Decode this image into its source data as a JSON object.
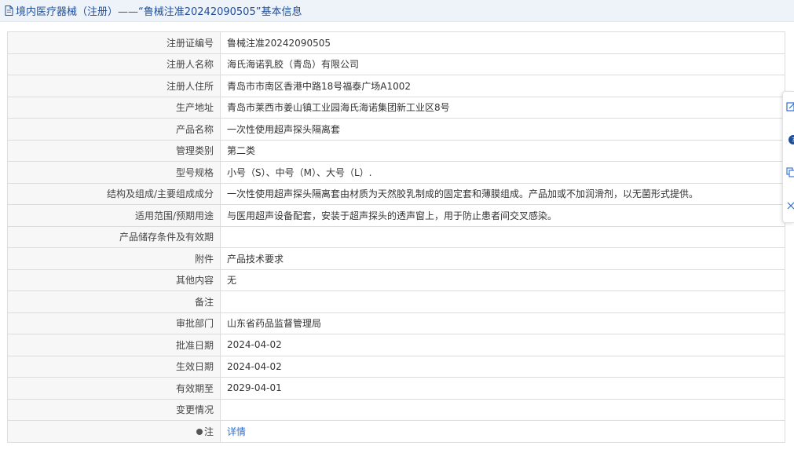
{
  "header": {
    "title": "境内医疗器械（注册）——“鲁械注准20242090505”基本信息",
    "icon": "document-icon"
  },
  "fields": [
    {
      "label": "注册证编号",
      "value": "鲁械注准20242090505"
    },
    {
      "label": "注册人名称",
      "value": "海氏海诺乳胶（青岛）有限公司"
    },
    {
      "label": "注册人住所",
      "value": "青岛市市南区香港中路18号福泰广场A1002"
    },
    {
      "label": "生产地址",
      "value": "青岛市莱西市姜山镇工业园海氏海诺集团新工业区8号"
    },
    {
      "label": "产品名称",
      "value": "一次性使用超声探头隔离套"
    },
    {
      "label": "管理类别",
      "value": "第二类"
    },
    {
      "label": "型号规格",
      "value": "小号（S）、中号（M）、大号（L）."
    },
    {
      "label": "结构及组成/主要组成成分",
      "value": "一次性使用超声探头隔离套由材质为天然胶乳制成的固定套和薄膜组成。产品加或不加润滑剂，以无菌形式提供。"
    },
    {
      "label": "适用范围/预期用途",
      "value": "与医用超声设备配套，安装于超声探头的透声窗上，用于防止患者间交叉感染。"
    },
    {
      "label": "产品储存条件及有效期",
      "value": ""
    },
    {
      "label": "附件",
      "value": "产品技术要求"
    },
    {
      "label": "其他内容",
      "value": "无"
    },
    {
      "label": "备注",
      "value": ""
    },
    {
      "label": "审批部门",
      "value": "山东省药品监督管理局"
    },
    {
      "label": "批准日期",
      "value": "2024-04-02"
    },
    {
      "label": "生效日期",
      "value": "2024-04-02"
    },
    {
      "label": "有效期至",
      "value": "2029-04-01"
    },
    {
      "label": "变更情况",
      "value": ""
    }
  ],
  "note_row": {
    "label": "注",
    "link_text": "详情"
  },
  "colors": {
    "header_text": "#1f4e9a",
    "header_bg": "#eef3f9",
    "label_bg": "#f7f7f7",
    "border": "#dcdcdc",
    "link": "#2d6ecf"
  },
  "side_toolbar": {
    "icons": [
      "edit-icon",
      "help-icon",
      "copy-icon",
      "close-icon"
    ]
  }
}
